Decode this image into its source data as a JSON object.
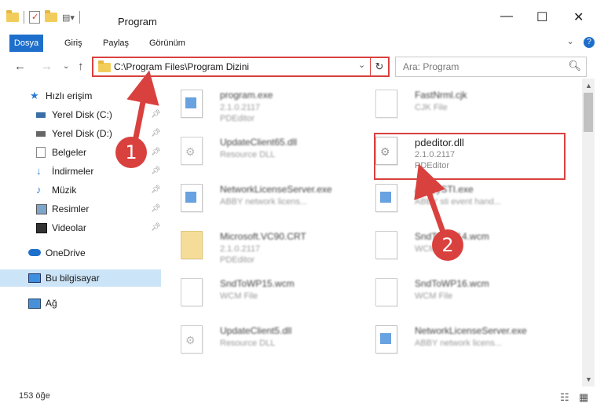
{
  "window": {
    "title": "Program",
    "minimize": "—",
    "maximize": "☐",
    "close": "✕"
  },
  "ribbon": {
    "tabs": [
      "Dosya",
      "Giriş",
      "Paylaş",
      "Görünüm"
    ],
    "expand": "⌄",
    "help": "?"
  },
  "nav_buttons": {
    "back": "←",
    "forward": "→",
    "recent": "⌄",
    "up": "↑"
  },
  "address": {
    "path": "C:\\Program Files\\Program Dizini",
    "dropdown": "⌄",
    "refresh": "↻"
  },
  "search": {
    "placeholder": "Ara: Program",
    "icon": "search-icon"
  },
  "sidebar": {
    "items": [
      {
        "label": "Hızlı erişim",
        "icon": "star-icon",
        "pinned": false
      },
      {
        "label": "Yerel Disk (C:)",
        "icon": "drive-icon",
        "pinned": true
      },
      {
        "label": "Yerel Disk (D:)",
        "icon": "drive-icon",
        "pinned": true
      },
      {
        "label": "Belgeler",
        "icon": "documents-icon",
        "pinned": true
      },
      {
        "label": "İndirmeler",
        "icon": "downloads-icon",
        "pinned": true
      },
      {
        "label": "Müzik",
        "icon": "music-icon",
        "pinned": true
      },
      {
        "label": "Resimler",
        "icon": "pictures-icon",
        "pinned": true
      },
      {
        "label": "Videolar",
        "icon": "videos-icon",
        "pinned": true
      },
      {
        "label": "OneDrive",
        "icon": "onedrive-icon",
        "pinned": false
      },
      {
        "label": "Bu bilgisayar",
        "icon": "computer-icon",
        "pinned": false
      },
      {
        "label": "Ağ",
        "icon": "network-icon",
        "pinned": false
      }
    ]
  },
  "files": [
    {
      "name": "program.exe",
      "line1": "2.1.0.2117",
      "line2": "PDEditor",
      "kind": "exe"
    },
    {
      "name": "FastNrml.cjk",
      "line1": "CJK File",
      "line2": "",
      "kind": "doc"
    },
    {
      "name": "UpdateClient65.dll",
      "line1": "Resource DLL",
      "line2": "",
      "kind": "gear"
    },
    {
      "name": "pdeditor.dll",
      "line1": "2.1.0.2117",
      "line2": "PDEditor",
      "kind": "gear"
    },
    {
      "name": "NetworkLicenseServer.exe",
      "line1": "ABBY network licens...",
      "line2": "",
      "kind": "exe"
    },
    {
      "name": "AbbyySTI.exe",
      "line1": "ABBY sti event hand...",
      "line2": "",
      "kind": "exe"
    },
    {
      "name": "Microsoft.VC90.CRT",
      "line1": "2.1.0.2117",
      "line2": "PDEditor",
      "kind": "folder"
    },
    {
      "name": "SndToWP14.wcm",
      "line1": "WCM File",
      "line2": "",
      "kind": "doc"
    },
    {
      "name": "SndToWP15.wcm",
      "line1": "WCM File",
      "line2": "",
      "kind": "doc"
    },
    {
      "name": "SndToWP16.wcm",
      "line1": "WCM File",
      "line2": "",
      "kind": "doc"
    },
    {
      "name": "UpdateClient5.dll",
      "line1": "Resource DLL",
      "line2": "",
      "kind": "gear"
    },
    {
      "name": "NetworkLicenseServer.exe",
      "line1": "ABBY network licens...",
      "line2": "",
      "kind": "exe"
    }
  ],
  "status": {
    "count": "153 öğe"
  },
  "callouts": {
    "one": "1",
    "two": "2"
  },
  "colors": {
    "accent": "#1e6fcc",
    "highlight": "#d9413e",
    "selected_nav": "#cce4f7"
  }
}
